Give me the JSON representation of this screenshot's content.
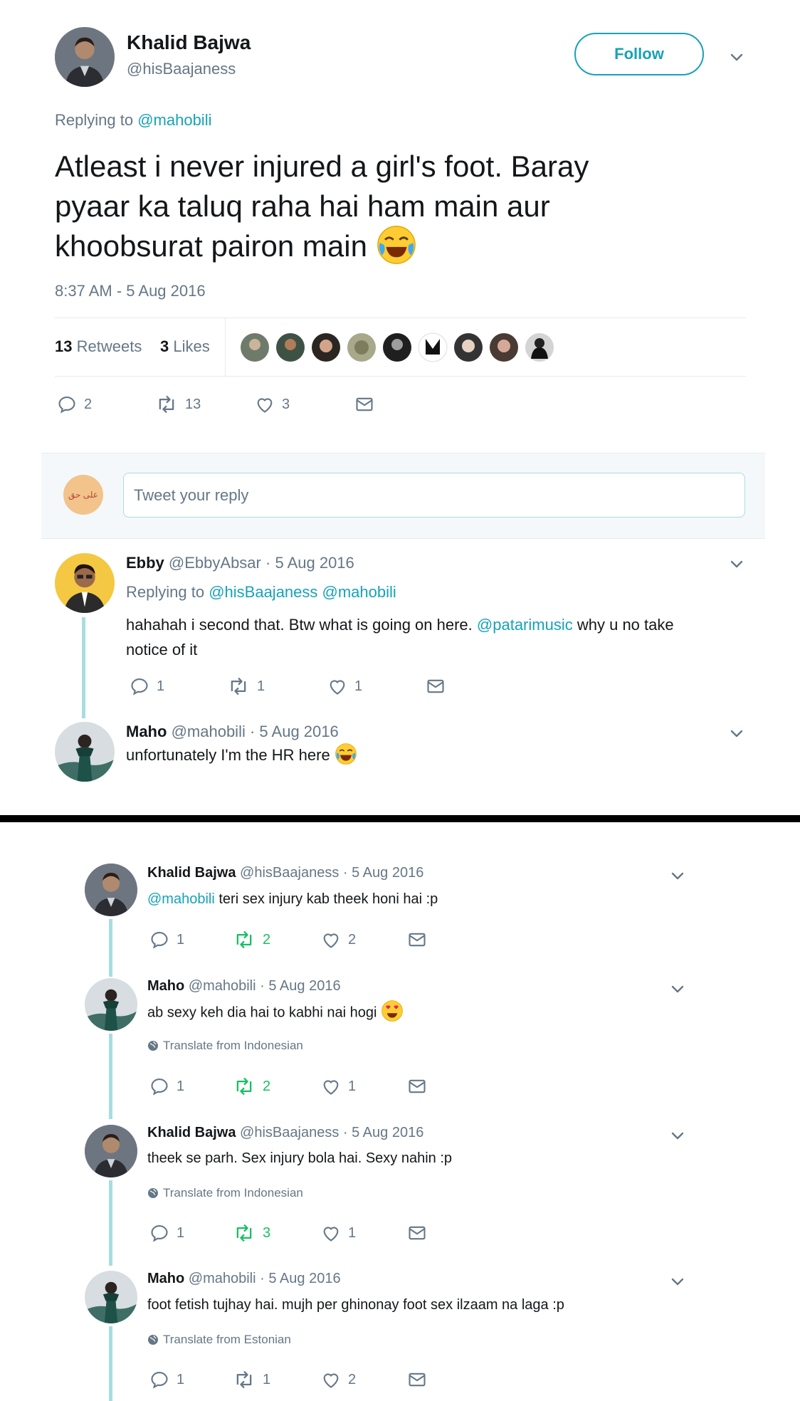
{
  "main_tweet": {
    "author_name": "Khalid Bajwa",
    "author_handle": "@hisBaajaness",
    "follow_label": "Follow",
    "replying_to_label": "Replying to",
    "replying_to_handle": "@mahobili",
    "text_line1": "Atleast i never injured a girl's foot. Baray",
    "text_line2": "pyaar ka taluq raha hai ham main aur",
    "text_line3": "khoobsurat pairon main",
    "timestamp": "8:37 AM - 5 Aug 2016",
    "retweets_count": "13",
    "retweets_label": "Retweets",
    "likes_count": "3",
    "likes_label": "Likes",
    "reply_count": "2",
    "retweet_count": "13",
    "like_count": "3"
  },
  "compose": {
    "placeholder": "Tweet your reply",
    "avatar_text": "علی حق"
  },
  "replies_top": [
    {
      "name": "Ebby",
      "handle": "@EbbyAbsar",
      "date": "· 5 Aug 2016",
      "replying_to_label": "Replying to",
      "replying_to_handles": "@hisBaajaness @mahobili",
      "text_a": "hahahah i second that. Btw what is going on here.",
      "mention": "@patarimusic",
      "text_b": "why u no take",
      "text_c": "notice of it",
      "reply_count": "1",
      "retweet_count": "1",
      "like_count": "1"
    },
    {
      "name": "Maho",
      "handle": "@mahobili",
      "date": "· 5 Aug 2016",
      "text": "unfortunately I'm the HR here"
    }
  ],
  "replies_bottom": [
    {
      "name": "Khalid Bajwa",
      "handle": "@hisBaajaness",
      "date": "· 5 Aug 2016",
      "mention": "@mahobili",
      "text": "teri sex injury kab theek honi hai :p",
      "reply_count": "1",
      "retweet_count": "2",
      "like_count": "2"
    },
    {
      "name": "Maho",
      "handle": "@mahobili",
      "date": "· 5 Aug 2016",
      "text": "ab sexy keh dia hai to kabhi nai hogi",
      "translate": "Translate from Indonesian",
      "reply_count": "1",
      "retweet_count": "2",
      "like_count": "1"
    },
    {
      "name": "Khalid Bajwa",
      "handle": "@hisBaajaness",
      "date": "· 5 Aug 2016",
      "text": "theek se parh. Sex injury bola hai. Sexy nahin :p",
      "translate": "Translate from Indonesian",
      "reply_count": "1",
      "retweet_count": "3",
      "like_count": "1"
    },
    {
      "name": "Maho",
      "handle": "@mahobili",
      "date": "· 5 Aug 2016",
      "text": "foot fetish tujhay hai. mujh per ghinonay foot sex ilzaam na laga :p",
      "translate": "Translate from Estonian",
      "reply_count": "1",
      "retweet_count": "1",
      "like_count": "2"
    }
  ],
  "colors": {
    "link": "#1b95e0",
    "accent": "#17a2b8",
    "retweeted": "#17bf63",
    "muted": "#657786",
    "thread": "#a9dde0"
  }
}
